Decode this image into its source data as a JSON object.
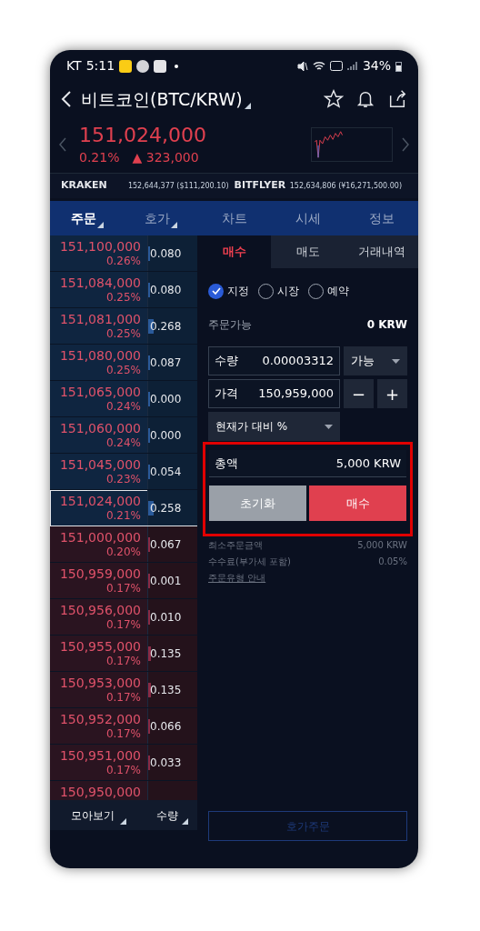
{
  "status_bar": {
    "carrier": "KT",
    "time": "5:11",
    "battery": "34%"
  },
  "header": {
    "title": "비트코인(BTC/KRW)",
    "price": "151,024,000",
    "change_pct": "0.21%",
    "change_symbol": "▲",
    "change_amount": "323,000"
  },
  "exchanges": [
    {
      "name": "KRAKEN",
      "value": "152,644,377 ($111,200.10)"
    },
    {
      "name": "BITFLYER",
      "value": "152,634,806 (¥16,271,500.00)"
    }
  ],
  "tabs": [
    {
      "label": "주문",
      "selected": true,
      "dropdown": true
    },
    {
      "label": "호가",
      "selected": false,
      "dropdown": true
    },
    {
      "label": "차트",
      "selected": false,
      "dropdown": false
    },
    {
      "label": "시세",
      "selected": false,
      "dropdown": false
    },
    {
      "label": "정보",
      "selected": false,
      "dropdown": false
    }
  ],
  "orderbook": [
    {
      "kind": "ask",
      "price": "151,100,000",
      "pct": "0.26%",
      "qty": "0.080",
      "level": 0.03,
      "selected": false
    },
    {
      "kind": "ask",
      "price": "151,084,000",
      "pct": "0.25%",
      "qty": "0.080",
      "level": 0.03,
      "selected": false
    },
    {
      "kind": "ask",
      "price": "151,081,000",
      "pct": "0.25%",
      "qty": "0.268",
      "level": 0.1,
      "selected": false
    },
    {
      "kind": "ask",
      "price": "151,080,000",
      "pct": "0.25%",
      "qty": "0.087",
      "level": 0.03,
      "selected": false
    },
    {
      "kind": "ask",
      "price": "151,065,000",
      "pct": "0.24%",
      "qty": "0.000",
      "level": 0,
      "selected": false
    },
    {
      "kind": "ask",
      "price": "151,060,000",
      "pct": "0.24%",
      "qty": "0.000",
      "level": 0,
      "selected": false
    },
    {
      "kind": "ask",
      "price": "151,045,000",
      "pct": "0.23%",
      "qty": "0.054",
      "level": 0.02,
      "selected": false
    },
    {
      "kind": "ask",
      "price": "151,024,000",
      "pct": "0.21%",
      "qty": "0.258",
      "level": 0.1,
      "selected": true
    },
    {
      "kind": "bid",
      "price": "151,000,000",
      "pct": "0.20%",
      "qty": "0.067",
      "level": 0.025,
      "selected": false
    },
    {
      "kind": "bid",
      "price": "150,959,000",
      "pct": "0.17%",
      "qty": "0.001",
      "level": 0,
      "selected": false
    },
    {
      "kind": "bid",
      "price": "150,956,000",
      "pct": "0.17%",
      "qty": "0.010",
      "level": 0,
      "selected": false
    },
    {
      "kind": "bid",
      "price": "150,955,000",
      "pct": "0.17%",
      "qty": "0.135",
      "level": 0.05,
      "selected": false
    },
    {
      "kind": "bid",
      "price": "150,953,000",
      "pct": "0.17%",
      "qty": "0.135",
      "level": 0.05,
      "selected": false
    },
    {
      "kind": "bid",
      "price": "150,952,000",
      "pct": "0.17%",
      "qty": "0.066",
      "level": 0.025,
      "selected": false
    },
    {
      "kind": "bid",
      "price": "150,951,000",
      "pct": "0.17%",
      "qty": "0.033",
      "level": 0.012,
      "selected": false
    },
    {
      "kind": "bid",
      "price": "150,950,000"
    }
  ],
  "orderbook_footer": [
    "모아보기",
    "수량"
  ],
  "order_tabs": [
    {
      "label": "매수",
      "selected": true
    },
    {
      "label": "매도",
      "selected": false
    },
    {
      "label": "거래내역",
      "selected": false
    }
  ],
  "order_types": [
    {
      "label": "지정",
      "selected": true
    },
    {
      "label": "시장",
      "selected": false
    },
    {
      "label": "예약",
      "selected": false
    }
  ],
  "available": {
    "label": "주문가능",
    "value": "0 KRW"
  },
  "quantity": {
    "label": "수량",
    "value": "0.00003312",
    "option": "가능"
  },
  "price": {
    "label": "가격",
    "value": "150,959,000",
    "minus": "−",
    "plus": "+"
  },
  "percent_select": "현재가 대비 %",
  "total": {
    "label": "총액",
    "value": "5,000 KRW",
    "highlighted": true
  },
  "buttons": {
    "reset": "초기화",
    "submit": "매수"
  },
  "info": [
    {
      "label": "최소주문금액",
      "value": "5,000 KRW"
    },
    {
      "label": "수수료(부가세 포함)",
      "value": "0.05%"
    }
  ],
  "guide_link": "주문유형 안내",
  "quote_order": {
    "label": "호가주문",
    "disabled": true
  }
}
